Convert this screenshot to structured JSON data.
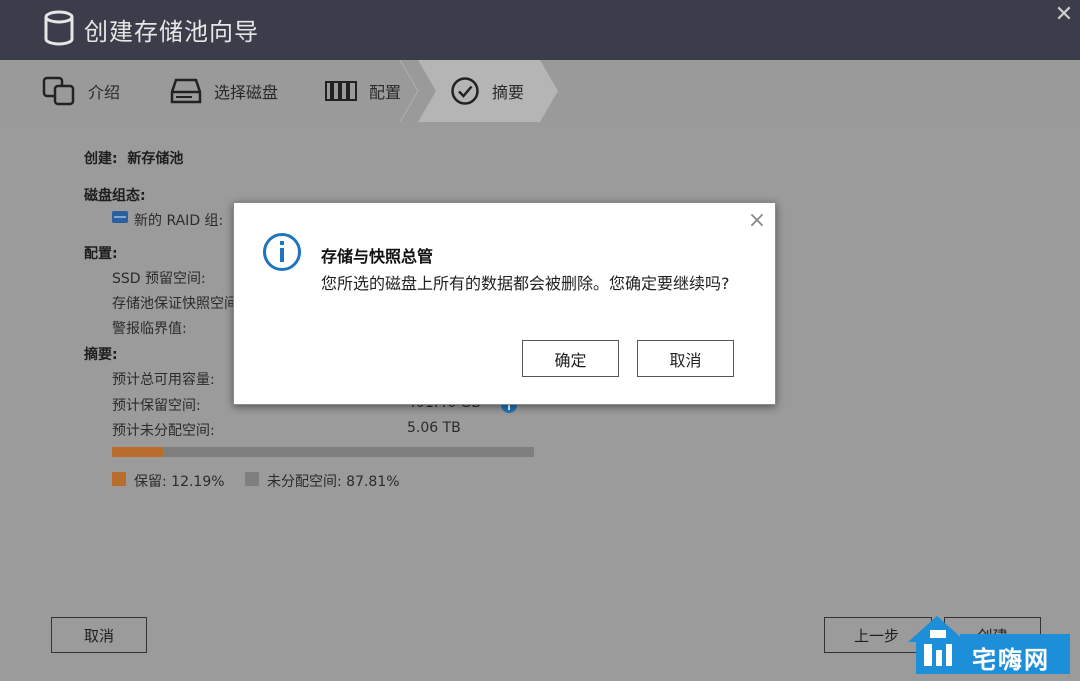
{
  "window": {
    "title": "创建存储池向导",
    "close_glyph": "✕"
  },
  "steps": [
    {
      "label": "介绍",
      "icon": "disks-icon"
    },
    {
      "label": "选择磁盘",
      "icon": "drive-icon"
    },
    {
      "label": "配置",
      "icon": "config-icon"
    },
    {
      "label": "摘要",
      "icon": "check-circle-icon",
      "active": true
    }
  ],
  "summary": {
    "create_label": "创建:",
    "create_value": "新存储池",
    "disk_group_label": "磁盘组态:",
    "raid_group_label": "新的 RAID 组:",
    "config_label": "配置:",
    "ssd_reserved_label": "SSD 预留空间:",
    "snapshot_guarantee_label": "存储池保证快照空间",
    "alert_threshold_label": "警报临界值:",
    "digest_label": "摘要:",
    "total_available_label": "预计总可用容量:",
    "reserved_space_label": "预计保留空间:",
    "reserved_space_value": "401.46 GB",
    "unallocated_label": "预计未分配空间:",
    "unallocated_value": "5.06 TB",
    "reserved_fraction": 0.1219,
    "legend_reserved": "保留:  12.19%",
    "legend_unallocated": "未分配空间:  87.81%"
  },
  "colors": {
    "reserved": "#b86d2c",
    "unallocated": "#7f7f7f",
    "titlebar": "#3b3e4a",
    "info_blue": "#1d75bd"
  },
  "buttons": {
    "cancel": "取消",
    "back": "上一步",
    "create": "创建"
  },
  "dialog": {
    "title": "存储与快照总管",
    "message": "您所选的磁盘上所有的数据都会被删除。您确定要继续吗?",
    "confirm": "确定",
    "cancel": "取消",
    "close_glyph": "×"
  },
  "watermark": {
    "text": "宅嗨网"
  }
}
